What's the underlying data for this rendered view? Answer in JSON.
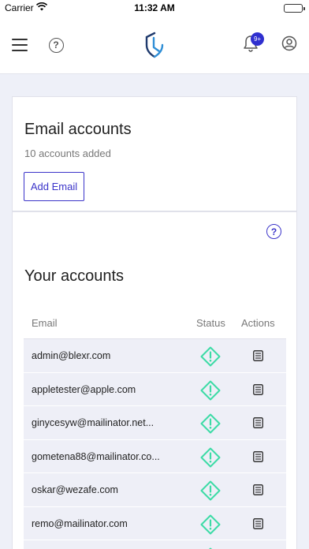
{
  "status_bar": {
    "carrier": "Carrier",
    "time": "11:32 AM"
  },
  "header": {
    "menu_icon": "hamburger-menu-icon",
    "help_icon": "question-circle-icon",
    "logo_icon": "shield-logo-icon",
    "notifications_icon": "bell-icon",
    "notification_badge": "9+",
    "profile_icon": "user-circle-icon",
    "badge_color": "#2f2fcf"
  },
  "email_card": {
    "title": "Email accounts",
    "subtitle": "10 accounts added",
    "add_button": "Add Email"
  },
  "accounts_card": {
    "help_icon": "question-circle-icon",
    "title": "Your accounts",
    "columns": {
      "email": "Email",
      "status": "Status",
      "actions": "Actions"
    },
    "rows": [
      {
        "email": "admin@blexr.com",
        "status_icon": "warning-diamond-icon",
        "action_icon": "list-icon"
      },
      {
        "email": "appletester@apple.com",
        "status_icon": "warning-diamond-icon",
        "action_icon": "list-icon"
      },
      {
        "email": "ginycesyw@mailinator.net...",
        "status_icon": "warning-diamond-icon",
        "action_icon": "list-icon"
      },
      {
        "email": "gometena88@mailinator.co...",
        "status_icon": "warning-diamond-icon",
        "action_icon": "list-icon"
      },
      {
        "email": "oskar@wezafe.com",
        "status_icon": "warning-diamond-icon",
        "action_icon": "list-icon"
      },
      {
        "email": "remo@mailinator.com",
        "status_icon": "warning-diamond-icon",
        "action_icon": "list-icon"
      },
      {
        "email": "",
        "status_icon": "warning-diamond-icon",
        "action_icon": "list-icon"
      }
    ],
    "status_color": "#3ddba6",
    "accent_color": "#3b34c9"
  }
}
